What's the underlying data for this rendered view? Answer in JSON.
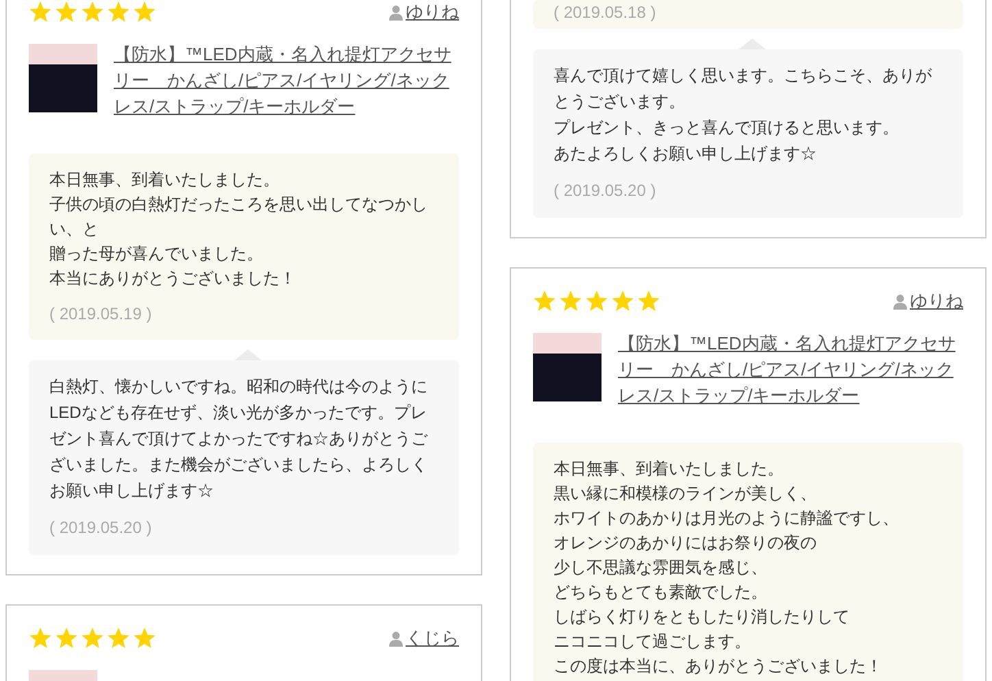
{
  "columns": [
    {
      "reviews": [
        {
          "stars": 5,
          "user": "ゆりね",
          "product": {
            "photo": true,
            "title": "【防水】™LED内蔵・名入れ提灯アクセサリー　かんざし/ピアス/イヤリング/ネックレス/ストラップ/キーホルダー"
          },
          "review": {
            "lines": [
              "本日無事、到着いたしました。",
              "子供の頃の白熱灯だったころを思い出してなつかしい、と",
              "贈った母が喜んでいました。",
              "本当にありがとうございました！"
            ],
            "date": "( 2019.05.19 )"
          },
          "reply": {
            "lines": [
              "白熱灯、懐かしいですね。昭和の時代は今のようにLEDなども存在せず、淡い光が多かったです。プレゼント喜んで頂けてよかったですね☆ありがとうございました。また機会がございましたら、よろしくお願い申し上げます☆"
            ],
            "date": "( 2019.05.20 )"
          }
        },
        {
          "stars": 5,
          "user": "くじら",
          "product": {
            "photo": true
          }
        }
      ]
    },
    {
      "reviews": [
        {
          "review": {
            "date": "( 2019.05.18 )"
          },
          "reply": {
            "lines": [
              "喜んで頂けて嬉しく思います。こちらこそ、ありがとうございます。",
              "プレゼント、きっと喜んで頂けると思います。",
              "あたよろしくお願い申し上げます☆"
            ],
            "date": "( 2019.05.20 )"
          }
        },
        {
          "stars": 5,
          "user": "ゆりね",
          "product": {
            "photo": true,
            "title": "【防水】™LED内蔵・名入れ提灯アクセサリー　かんざし/ピアス/イヤリング/ネックレス/ストラップ/キーホルダー"
          },
          "review": {
            "lines": [
              "本日無事、到着いたしました。",
              "黒い縁に和模様のラインが美しく、",
              "ホワイトのあかりは月光のように静謐ですし、",
              "オレンジのあかりにはお祭りの夜の",
              "少し不思議な雰囲気を感じ、",
              "どちらもとても素敵でした。",
              "しばらく灯りをともしたり消したりして",
              "ニコニコして過ごします。",
              "この度は本当に、ありがとうございました！"
            ]
          }
        }
      ]
    }
  ]
}
